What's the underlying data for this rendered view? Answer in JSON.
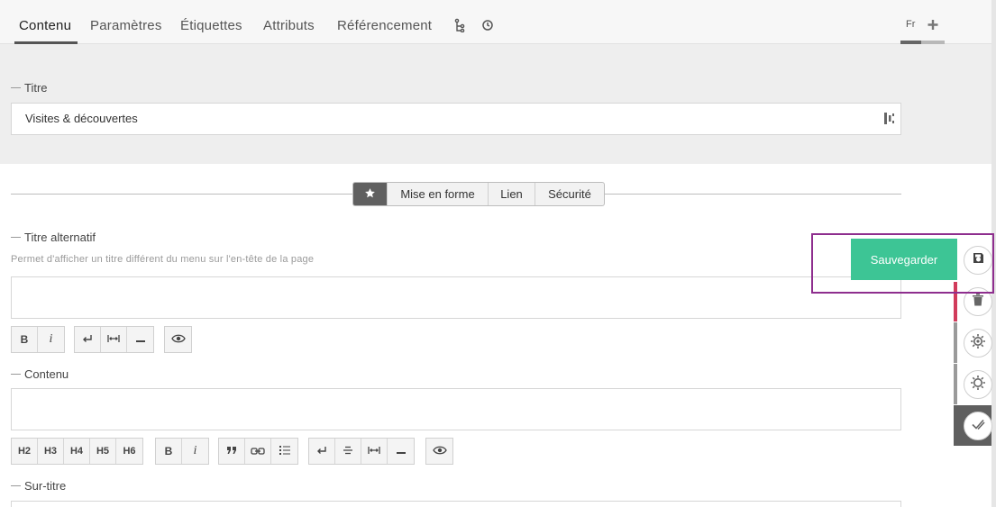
{
  "tabs": {
    "items": [
      {
        "label": "Contenu",
        "active": true
      },
      {
        "label": "Paramètres"
      },
      {
        "label": "Étiquettes"
      },
      {
        "label": "Attributs"
      },
      {
        "label": "Référencement"
      }
    ],
    "extra_icons": [
      "tree-icon",
      "history-icon"
    ],
    "language": "Fr",
    "add_language_icon": "plus-icon"
  },
  "title_field": {
    "label": "Titre",
    "value": "Visites & découvertes",
    "icon": "translate-icon"
  },
  "section_tabs": {
    "items": [
      {
        "label": "",
        "icon": "star-icon",
        "active": true
      },
      {
        "label": "Mise en forme"
      },
      {
        "label": "Lien"
      },
      {
        "label": "Sécurité"
      }
    ]
  },
  "alt_title_field": {
    "label": "Titre alternatif",
    "hint": "Permet d'afficher un titre différent du menu sur l'en-tête de la page",
    "value": ""
  },
  "alt_title_toolbar": {
    "bold": "B",
    "italic": "i",
    "icons": [
      "line-break-icon",
      "nonbreaking-space-icon",
      "horizontal-rule-icon",
      "preview-icon"
    ]
  },
  "content_field": {
    "label": "Contenu",
    "value": ""
  },
  "content_toolbar": {
    "headings": [
      "H2",
      "H3",
      "H4",
      "H5",
      "H6"
    ],
    "bold": "B",
    "italic": "i",
    "icons": [
      "quote-icon",
      "link-icon",
      "list-icon",
      "line-break-icon",
      "strikethrough-icon",
      "nonbreaking-space-icon",
      "horizontal-rule-icon",
      "preview-icon"
    ]
  },
  "subtitle_field": {
    "label": "Sur-titre"
  },
  "actions": {
    "save_label": "Sauvegarder",
    "icons": [
      "save-icon",
      "trash-icon",
      "settings-gear-icon",
      "gear-icon",
      "check-icon"
    ],
    "colors": {
      "save": "#3dc595",
      "delete_bar": "#d13b5b",
      "strip_bar": "#9a9a9a",
      "active_bg": "#5f5f5f",
      "frame": "#8e2e8e"
    }
  }
}
